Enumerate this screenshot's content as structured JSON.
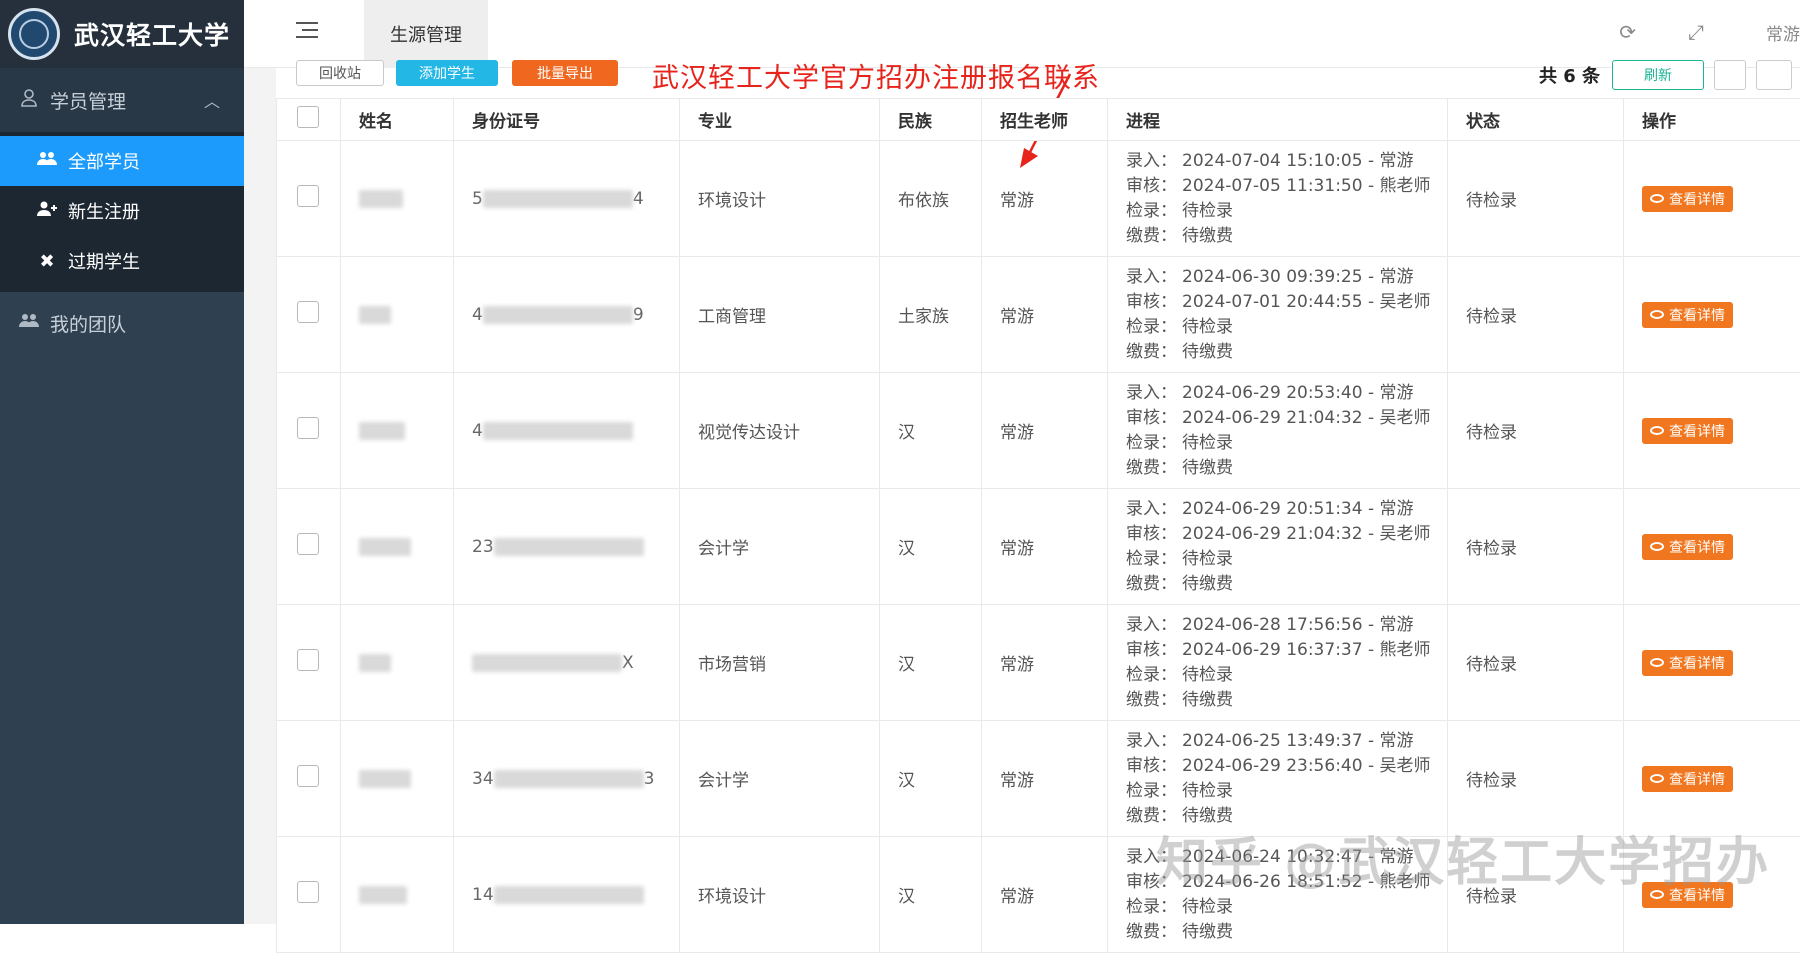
{
  "sidebar": {
    "brand": "武汉轻工大学",
    "logo_label": "logo",
    "group_label": "学员管理",
    "items": [
      {
        "label": "全部学员",
        "icon": "users-icon",
        "active": true
      },
      {
        "label": "新生注册",
        "icon": "user-plus-icon",
        "active": false
      },
      {
        "label": "过期学生",
        "icon": "times-icon",
        "active": false
      }
    ],
    "team_label": "我的团队"
  },
  "topbar": {
    "tab_label": "生源管理",
    "user_name": "常游"
  },
  "toolbar": {
    "recycle_label": "回收站",
    "add_label": "添加学生",
    "export_label": "批量导出",
    "total_label": "共 6 条",
    "refresh_label": "刷新"
  },
  "annotation": "武汉轻工大学官方招办注册报名联系",
  "watermark": "知乎 @武汉轻工大学招办",
  "table": {
    "headers": {
      "name": "姓名",
      "id": "身份证号",
      "major": "专业",
      "ethnicity": "民族",
      "teacher": "招生老师",
      "progress": "进程",
      "status": "状态",
      "action": "操作"
    },
    "progress_keys": {
      "entry": "录入：",
      "review": "审核：",
      "check": "检录：",
      "fee": "缴费："
    },
    "action_label": "查看详情",
    "rows": [
      {
        "id_start": "5",
        "id_end": "4",
        "major": "环境设计",
        "ethnicity": "布依族",
        "teacher": "常游",
        "entry": "2024-07-04 15:10:05 - 常游",
        "review": "2024-07-05 11:31:50 - 熊老师",
        "check": "待检录",
        "fee": "待缴费",
        "status": "待检录"
      },
      {
        "id_start": "4",
        "id_end": "9",
        "major": "工商管理",
        "ethnicity": "土家族",
        "teacher": "常游",
        "entry": "2024-06-30 09:39:25 - 常游",
        "review": "2024-07-01 20:44:55 - 吴老师",
        "check": "待检录",
        "fee": "待缴费",
        "status": "待检录"
      },
      {
        "id_start": "4",
        "id_end": "",
        "major": "视觉传达设计",
        "ethnicity": "汉",
        "teacher": "常游",
        "entry": "2024-06-29 20:53:40 - 常游",
        "review": "2024-06-29 21:04:32 - 吴老师",
        "check": "待检录",
        "fee": "待缴费",
        "status": "待检录"
      },
      {
        "id_start": "23",
        "id_end": "",
        "major": "会计学",
        "ethnicity": "汉",
        "teacher": "常游",
        "entry": "2024-06-29 20:51:34 - 常游",
        "review": "2024-06-29 21:04:32 - 吴老师",
        "check": "待检录",
        "fee": "待缴费",
        "status": "待检录"
      },
      {
        "id_start": "",
        "id_end": "X",
        "major": "市场营销",
        "ethnicity": "汉",
        "teacher": "常游",
        "entry": "2024-06-28 17:56:56 - 常游",
        "review": "2024-06-29 16:37:37 - 熊老师",
        "check": "待检录",
        "fee": "待缴费",
        "status": "待检录"
      },
      {
        "id_start": "34",
        "id_end": "3",
        "major": "会计学",
        "ethnicity": "汉",
        "teacher": "常游",
        "entry": "2024-06-25 13:49:37 - 常游",
        "review": "2024-06-29 23:56:40 - 吴老师",
        "check": "待检录",
        "fee": "待缴费",
        "status": "待检录"
      },
      {
        "id_start": "14",
        "id_end": "",
        "major": "环境设计",
        "ethnicity": "汉",
        "teacher": "常游",
        "entry": "2024-06-24 10:32:47 - 常游",
        "review": "2024-06-26 18:51:52 - 熊老师",
        "check": "待检录",
        "fee": "待缴费",
        "status": "待检录"
      }
    ]
  },
  "colors": {
    "sidebar_bg": "#2f4050",
    "active_item": "#1c9bfd",
    "annotation_red": "#e7241c",
    "action_orange": "#f0761f"
  }
}
